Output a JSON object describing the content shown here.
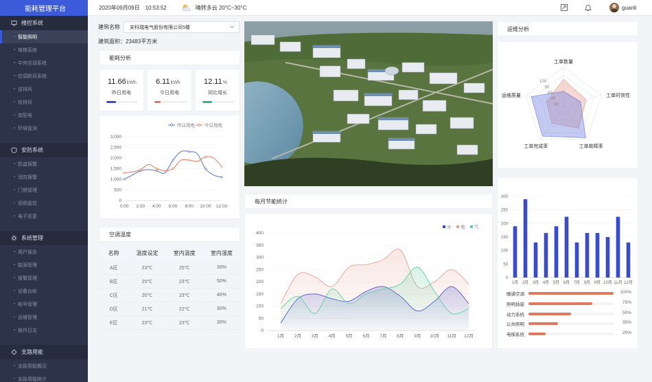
{
  "app": {
    "title": "能耗管理平台"
  },
  "sidebar": {
    "sections": [
      {
        "label": "楼控系统",
        "icon": "monitor-icon",
        "items": [
          {
            "label": "智能照明",
            "active": true
          },
          {
            "label": "电梯系统",
            "active": false
          },
          {
            "label": "中央空调系统",
            "active": false
          },
          {
            "label": "空调新风系统",
            "active": false
          },
          {
            "label": "送排风",
            "active": false
          },
          {
            "label": "给排风",
            "active": false
          },
          {
            "label": "变配电",
            "active": false
          },
          {
            "label": "环境监测",
            "active": false
          }
        ]
      },
      {
        "label": "安防系统",
        "icon": "shield-icon",
        "items": [
          {
            "label": "防盗报警"
          },
          {
            "label": "消防报警"
          },
          {
            "label": "门禁管理"
          },
          {
            "label": "视频监控"
          },
          {
            "label": "电子巡更"
          }
        ]
      },
      {
        "label": "系统管理",
        "icon": "gear-icon",
        "items": [
          {
            "label": "用户报告"
          },
          {
            "label": "能源管理"
          },
          {
            "label": "报警管理"
          },
          {
            "label": "设备台帐"
          },
          {
            "label": "帐号管理"
          },
          {
            "label": "运维管理"
          },
          {
            "label": "操作日志"
          }
        ]
      },
      {
        "label": "支路用能",
        "icon": "branch-icon",
        "items": [
          {
            "label": "支路用能概况"
          },
          {
            "label": "支路用能统计"
          }
        ]
      }
    ]
  },
  "header": {
    "date": "2020年09月09日",
    "time": "10:53:52",
    "weather": "晴转多云 20°C~30°C",
    "username": "guanli"
  },
  "building": {
    "name_label": "建筑名称",
    "name_value": "安科瑞电气股份有限公司5楼",
    "area_text": "建筑面积：23483平方米"
  },
  "energy": {
    "title": "能耗分析",
    "kpis": [
      {
        "value": "11.66",
        "unit": "kWh",
        "label": "昨日用电",
        "progress": 0.3,
        "color": "#3b4cca"
      },
      {
        "value": "6.11",
        "unit": "kWh",
        "label": "今日用电",
        "progress": 0.2,
        "color": "#e07a5f"
      },
      {
        "value": "12.11",
        "unit": "%",
        "label": "同比增长",
        "progress": 0.3,
        "color": "#36b37e"
      }
    ]
  },
  "ac": {
    "title": "空调温度",
    "headers": [
      "名称",
      "温度设定",
      "室内温度",
      "室内湿度"
    ],
    "rows": [
      [
        "A区",
        "23℃",
        "25℃",
        "30%"
      ],
      [
        "B区",
        "25℃",
        "23℃",
        "50%"
      ],
      [
        "C区",
        "20℃",
        "23℃",
        "40%"
      ],
      [
        "D区",
        "21℃",
        "22℃",
        "30%"
      ],
      [
        "E区",
        "23℃",
        "23℃",
        "30%"
      ]
    ]
  },
  "monthly": {
    "title": "每月节能统计"
  },
  "ops": {
    "title": "运维分析"
  },
  "chart_data": [
    {
      "id": "daily-power",
      "type": "line",
      "categories": [
        "0:00",
        "2:00",
        "4:00",
        "6:00",
        "8:00",
        "10:00",
        "12:00"
      ],
      "ylim": [
        0,
        3000
      ],
      "yticks": [
        "0",
        "500",
        "1,000",
        "1,500",
        "2,000",
        "2,500",
        "3,000"
      ],
      "series": [
        {
          "name": "昨日用电",
          "color": "#5470c6",
          "x": [
            0,
            0.5,
            1,
            1.5,
            2,
            2.5,
            3,
            3.5,
            4,
            4.5,
            5,
            5.5,
            6
          ],
          "values": [
            1000,
            1200,
            1400,
            1450,
            1400,
            1300,
            1900,
            2300,
            2300,
            2200,
            1500,
            1200,
            1100
          ]
        },
        {
          "name": "今日用电",
          "color": "#e07a5f",
          "x": [
            0,
            0.5,
            1,
            1.5,
            2,
            2.5,
            3,
            3.5,
            4,
            4.5,
            5,
            5.5,
            6
          ],
          "values": [
            1300,
            1350,
            1450,
            1700,
            1500,
            1400,
            1500,
            1900,
            1900,
            1850,
            2050,
            2000,
            1600
          ]
        }
      ]
    },
    {
      "id": "monthly-saving",
      "type": "area",
      "categories": [
        "1月",
        "2月",
        "3月",
        "4月",
        "5月",
        "6月",
        "7月",
        "8月",
        "9月",
        "10月",
        "11月",
        "12月"
      ],
      "ylim": [
        0,
        400
      ],
      "yticks": [
        "0",
        "50",
        "100",
        "150",
        "200",
        "250",
        "300",
        "350",
        "400"
      ],
      "series": [
        {
          "name": "水",
          "color": "#3b4cca",
          "values": [
            30,
            130,
            150,
            130,
            120,
            160,
            180,
            140,
            80,
            120,
            180,
            110
          ]
        },
        {
          "name": "电",
          "color": "#e8a090",
          "values": [
            110,
            230,
            220,
            180,
            260,
            270,
            290,
            330,
            180,
            200,
            250,
            190
          ]
        },
        {
          "name": "气",
          "color": "#5fcfa4",
          "values": [
            90,
            140,
            70,
            170,
            110,
            150,
            170,
            190,
            260,
            160,
            70,
            90
          ]
        }
      ]
    },
    {
      "id": "ops-radar",
      "type": "radar",
      "indicators": [
        "工单数量",
        "工单时效性",
        "工单故障率",
        "工单完成率",
        "运维质量"
      ],
      "scale_labels": [
        "20",
        "40",
        "60",
        "80",
        "100"
      ],
      "max": 100,
      "series": [
        {
          "color": "#e8a090",
          "values": [
            70,
            60,
            65,
            50,
            45
          ]
        },
        {
          "color": "#6c7ce0",
          "values": [
            40,
            45,
            95,
            90,
            85
          ]
        }
      ]
    },
    {
      "id": "monthly-bars",
      "type": "bar",
      "categories": [
        "1月",
        "2月",
        "3月",
        "4月",
        "5月",
        "6月",
        "7月",
        "8月",
        "9月",
        "10月",
        "11月",
        "12月"
      ],
      "ylim": [
        0,
        300
      ],
      "yticks": [
        "0",
        "50",
        "100",
        "150",
        "200",
        "250",
        "300"
      ],
      "values": [
        190,
        290,
        130,
        165,
        190,
        225,
        130,
        165,
        165,
        150,
        225,
        130
      ],
      "color": "#3b4cca"
    },
    {
      "id": "system-share",
      "type": "bar",
      "items": [
        {
          "label": "暖通空调",
          "value": 100
        },
        {
          "label": "照明插座",
          "value": 75
        },
        {
          "label": "动力系统",
          "value": 50
        },
        {
          "label": "公共照明",
          "value": 35
        },
        {
          "label": "电梯系统",
          "value": 20
        }
      ],
      "unit": "%"
    }
  ]
}
